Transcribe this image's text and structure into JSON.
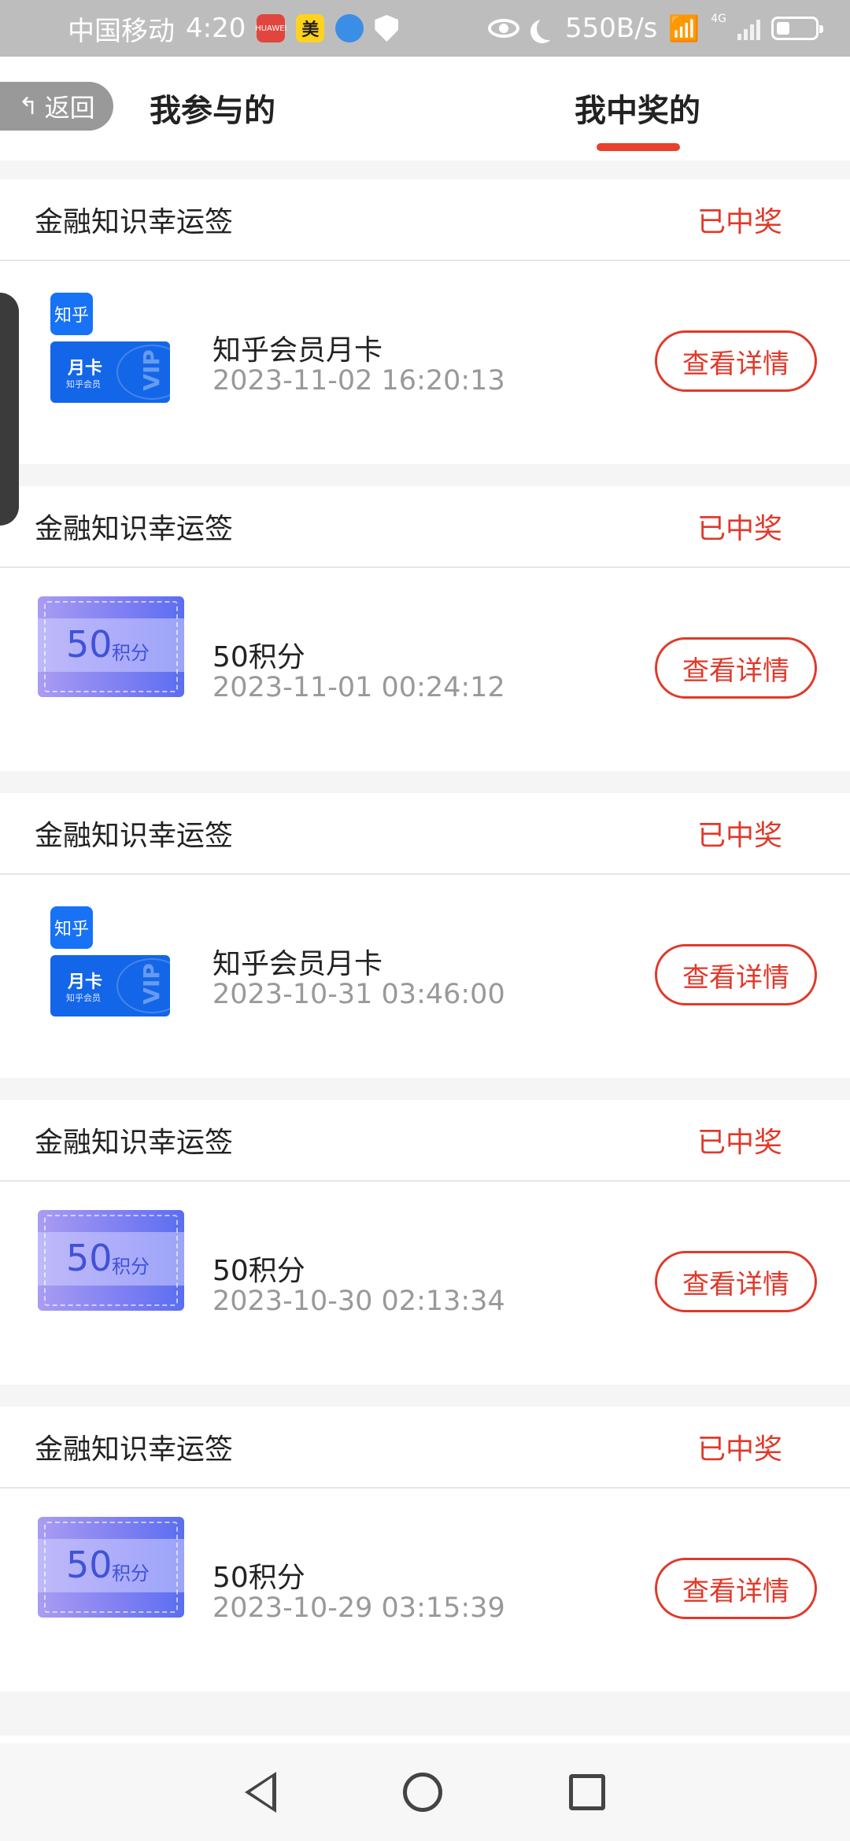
{
  "status_bar": {
    "carrier": "中国移动",
    "time": "4:20",
    "speed": "550B/s",
    "network": "4G",
    "app_icons": [
      "huawei-store-icon",
      "meituan-icon",
      "browser-icon",
      "shield-icon"
    ]
  },
  "header": {
    "back_label": "返回",
    "tabs": [
      {
        "label": "我参与的",
        "active": false
      },
      {
        "label": "我中奖的",
        "active": true
      }
    ]
  },
  "records": [
    {
      "title": "金融知识幸运签",
      "status": "已中奖",
      "prize": "知乎会员月卡",
      "time": "2023-11-02 16:20:13",
      "prize_type": "zhihu",
      "button": "查看详情"
    },
    {
      "title": "金融知识幸运签",
      "status": "已中奖",
      "prize": "50积分",
      "time": "2023-11-01 00:24:12",
      "prize_type": "points",
      "button": "查看详情"
    },
    {
      "title": "金融知识幸运签",
      "status": "已中奖",
      "prize": "知乎会员月卡",
      "time": "2023-10-31 03:46:00",
      "prize_type": "zhihu",
      "button": "查看详情"
    },
    {
      "title": "金融知识幸运签",
      "status": "已中奖",
      "prize": "50积分",
      "time": "2023-10-30 02:13:34",
      "prize_type": "points",
      "button": "查看详情"
    },
    {
      "title": "金融知识幸运签",
      "status": "已中奖",
      "prize": "50积分",
      "time": "2023-10-29 03:15:39",
      "prize_type": "points",
      "button": "查看详情"
    }
  ],
  "prize_images": {
    "zhihu": {
      "logo": "知乎",
      "card_title": "月卡",
      "card_sub": "知乎会员",
      "card_mark": "VIP"
    },
    "points": {
      "amount": "50",
      "unit": "积分"
    }
  },
  "colors": {
    "accent": "#e0392a",
    "zhihu_blue": "#1466e8",
    "points_purple": "#7d7ef3"
  }
}
